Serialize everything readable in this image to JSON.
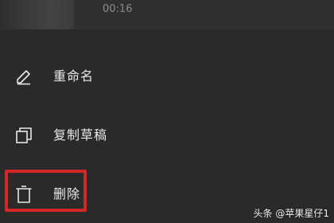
{
  "header": {
    "duration": "00:16"
  },
  "menu": {
    "items": [
      {
        "label": "重命名",
        "icon": "pencil-icon"
      },
      {
        "label": "复制草稿",
        "icon": "copy-icon"
      },
      {
        "label": "删除",
        "icon": "trash-icon"
      }
    ],
    "highlighted_item": "删除"
  },
  "watermark": {
    "text": "头条 @苹果星仔1"
  },
  "colors": {
    "background": "#2b2b2b",
    "text": "#e8e8e8",
    "highlight": "#d32626"
  }
}
